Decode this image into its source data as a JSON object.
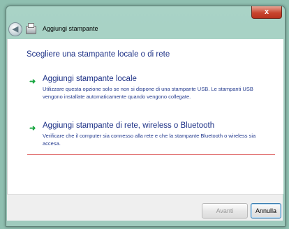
{
  "window": {
    "title": "Aggiungi stampante",
    "close_label": "x"
  },
  "wizard": {
    "heading": "Scegliere una stampante locale o di rete",
    "options": [
      {
        "title": "Aggiungi stampante locale",
        "description": "Utilizzare questa opzione solo se non si dispone di una stampante USB. Le stampanti USB vengono installate automaticamente quando vengono collegate."
      },
      {
        "title": "Aggiungi stampante di rete, wireless o Bluetooth",
        "description": "Verificare che il computer sia connesso alla rete e che la stampante Bluetooth o wireless sia accesa."
      }
    ]
  },
  "footer": {
    "next_label": "Avanti",
    "cancel_label": "Annulla"
  },
  "colors": {
    "heading_blue": "#1e3287",
    "arrow_green": "#18a640",
    "selection_line": "#e06a6a",
    "close_red": "#c8452f"
  },
  "icons": [
    "back-arrow-icon",
    "printer-icon",
    "green-arrow-icon"
  ]
}
